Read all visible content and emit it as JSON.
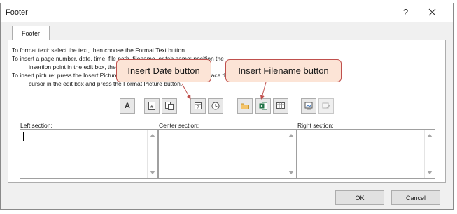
{
  "window": {
    "title": "Footer",
    "help_glyph": "?"
  },
  "tab": {
    "label": "Footer"
  },
  "instructions": {
    "line1": "To format text:  select the text, then choose the Format Text button.",
    "line2": "To insert a page number, date, time, file path, filename, or tab name:  position the",
    "line3": "insertion point in the edit box, then",
    "line4": "To insert picture: press the Insert Picture",
    "line4b": "place the",
    "line5": "cursor in the edit box and press the Format Picture button."
  },
  "toolbar": {
    "format_text_glyph": "A",
    "icons": [
      "format-text-icon",
      "insert-page-number-icon",
      "insert-number-of-pages-icon",
      "insert-date-icon",
      "insert-time-icon",
      "insert-file-path-icon",
      "insert-filename-icon",
      "insert-sheet-name-icon",
      "insert-picture-icon",
      "format-picture-icon"
    ]
  },
  "sections": {
    "left": "Left section:",
    "center": "Center section:",
    "right": "Right section:",
    "left_value": "",
    "center_value": "",
    "right_value": ""
  },
  "buttons": {
    "ok": "OK",
    "cancel": "Cancel"
  },
  "callouts": {
    "date": "Insert Date button",
    "filename": "Insert Filename button"
  },
  "colors": {
    "callout_fill": "#fce4d6",
    "callout_border": "#c0504d",
    "excel_green": "#217346"
  }
}
